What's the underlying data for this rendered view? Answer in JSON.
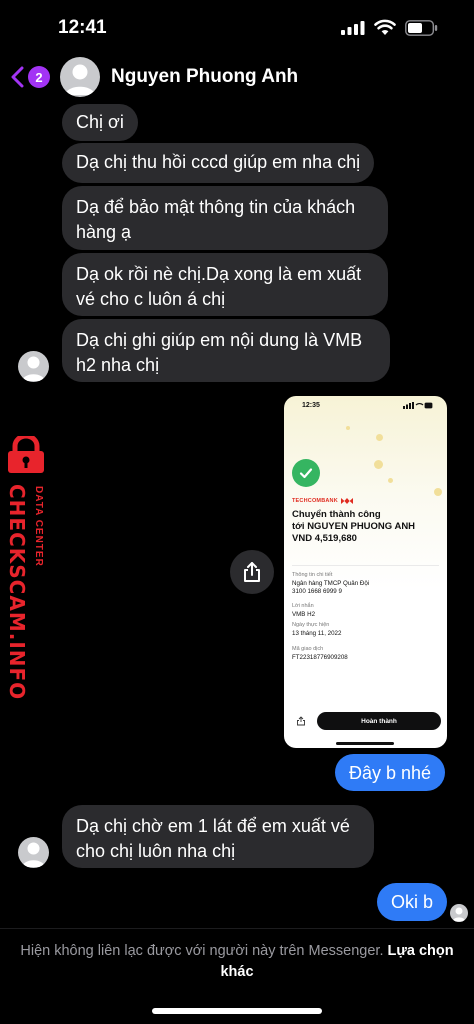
{
  "status_bar": {
    "time": "12:41"
  },
  "header": {
    "unread_count": "2",
    "contact_name": "Nguyen Phuong Anh"
  },
  "messages": [
    {
      "text": "Chị ơi"
    },
    {
      "text": "Dạ chị thu hồi cccd giúp em nha chị"
    },
    {
      "text": "Dạ để bảo mật thông tin của khách hàng ạ"
    },
    {
      "text": "Dạ ok rồi nè chị.Dạ xong là em xuất vé cho c luôn á chị"
    },
    {
      "text": "Dạ chị ghi giúp em nội dung là VMB h2 nha chị"
    },
    {
      "text": "Đây b nhé"
    },
    {
      "text": "Dạ chị chờ em 1 lát để em xuất vé cho chị luôn nha chị"
    },
    {
      "text": "Oki b"
    }
  ],
  "receipt": {
    "time": "12:35",
    "bank_logo": "TECHCOMBANK",
    "title_line1": "Chuyển thành công",
    "title_line2": "tới NGUYEN PHUONG ANH",
    "amount": "VND 4,519,680",
    "recipient_label": "Thông tin chi tiết",
    "recipient_bank": "Ngân hàng TMCP Quân Đội",
    "recipient_account": "3100 1668 6999 9",
    "message_label": "Lời nhắn",
    "message_value": "VMB H2",
    "date_label": "Ngày thực hiện",
    "date_value": "13 tháng 11, 2022",
    "txn_label": "Mã giao dịch",
    "txn_value": "FT22318776909208",
    "done_button": "Hoàn thành"
  },
  "watermark": {
    "main": "CHECKSCAM.INFO",
    "sub": "DATA CENTER"
  },
  "footer": {
    "notice": "Hiện không liên lạc được với người này trên Messenger.",
    "link": "Lựa chọn khác"
  },
  "colors": {
    "incoming_bubble": "#2b2b2e",
    "outgoing_bubble": "#2f7bf6",
    "badge": "#a334f5",
    "watermark": "#e8242c",
    "success_check": "#35b561"
  },
  "icons": [
    "signal-icon",
    "wifi-icon",
    "battery-icon",
    "back-chevron-icon",
    "avatar-icon",
    "share-icon",
    "check-icon",
    "lock-icon"
  ]
}
